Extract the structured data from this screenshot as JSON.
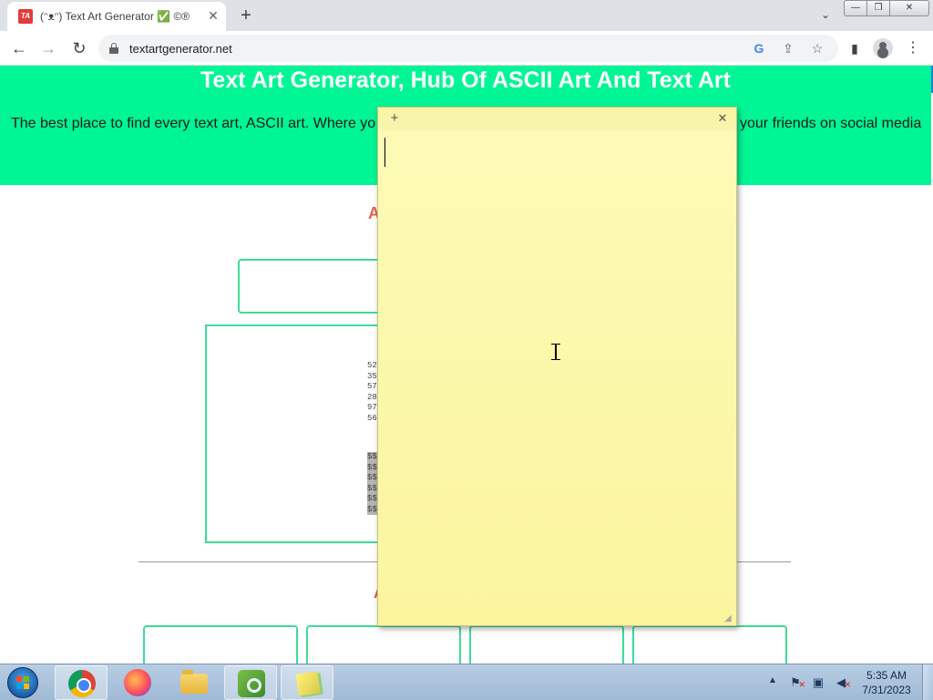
{
  "browser": {
    "tab": {
      "favicon_text": "TA",
      "title": "(ᵔᴥᵔ) Text Art Generator ✅ ©®"
    },
    "window_controls": {
      "minimize": "—",
      "maximize": "❐",
      "close": "✕"
    },
    "url": "textartgenerator.net",
    "icons": [
      "back-arrow-icon",
      "forward-arrow-icon",
      "reload-icon",
      "lock-icon",
      "google-icon",
      "share-icon",
      "star-icon",
      "side-panel-icon",
      "profile-icon",
      "menu-icon"
    ]
  },
  "page": {
    "hero_title": "Text Art Generator, Hub Of ASCII Art And Text Art",
    "hero_desc_left": "The best place to find every text art, ASCII art. Where yo",
    "hero_desc_right": "your friends on social media",
    "section_head_1": "A",
    "section_head_2": "A",
    "ascii_numbers": [
      "52",
      "35",
      "57",
      "28",
      "97",
      "56"
    ],
    "ascii_selected": [
      "$$",
      "$$",
      "$$",
      "$$",
      "$$",
      "$$"
    ],
    "colors": {
      "hero_bg": "#00f595",
      "heading": "#e2624a",
      "box_border": "#3ddc97"
    }
  },
  "sticky_note": {
    "add_label": "+",
    "close_label": "✕",
    "text": "",
    "color": "#fdfbb8"
  },
  "taskbar": {
    "apps": [
      "Google Chrome",
      "Mozilla Firefox",
      "Windows Explorer",
      "Spy tool",
      "Sticky Notes"
    ],
    "time": "5:35 AM",
    "date": "7/31/2023",
    "tray_arrow": "▲"
  }
}
